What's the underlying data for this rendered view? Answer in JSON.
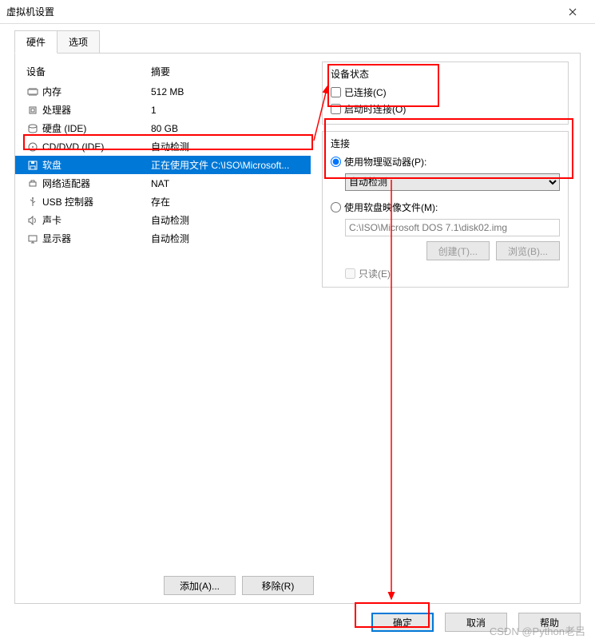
{
  "window": {
    "title": "虚拟机设置"
  },
  "tabs": {
    "hardware": "硬件",
    "options": "选项"
  },
  "columns": {
    "device": "设备",
    "summary": "摘要"
  },
  "devices": [
    {
      "icon": "memory-icon",
      "name": "内存",
      "summary": "512 MB"
    },
    {
      "icon": "cpu-icon",
      "name": "处理器",
      "summary": "1"
    },
    {
      "icon": "disk-icon",
      "name": "硬盘 (IDE)",
      "summary": "80 GB"
    },
    {
      "icon": "cd-icon",
      "name": "CD/DVD (IDE)",
      "summary": "自动检测"
    },
    {
      "icon": "floppy-icon",
      "name": "软盘",
      "summary": "正在使用文件 C:\\ISO\\Microsoft..."
    },
    {
      "icon": "network-icon",
      "name": "网络适配器",
      "summary": "NAT"
    },
    {
      "icon": "usb-icon",
      "name": "USB 控制器",
      "summary": "存在"
    },
    {
      "icon": "sound-icon",
      "name": "声卡",
      "summary": "自动检测"
    },
    {
      "icon": "display-icon",
      "name": "显示器",
      "summary": "自动检测"
    }
  ],
  "deviceStatus": {
    "legend": "设备状态",
    "connected": "已连接(C)",
    "connectAtPowerOn": "启动时连接(O)"
  },
  "connection": {
    "legend": "连接",
    "usePhysical": "使用物理驱动器(P):",
    "physicalSelected": "自动检测",
    "useImage": "使用软盘映像文件(M):",
    "imagePath": "C:\\ISO\\Microsoft DOS 7.1\\disk02.img",
    "createBtn": "创建(T)...",
    "browseBtn": "浏览(B)...",
    "readonly": "只读(E)"
  },
  "bottom": {
    "add": "添加(A)...",
    "remove": "移除(R)",
    "ok": "确定",
    "cancel": "取消",
    "help": "帮助"
  },
  "watermark": "CSDN @Python老吕"
}
